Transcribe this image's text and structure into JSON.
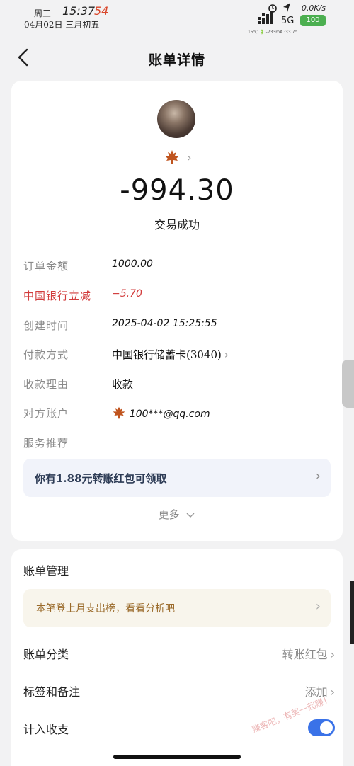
{
  "status_bar": {
    "weekday": "周三",
    "time": "15:37",
    "seconds": "54",
    "date": "04月02日  三月初五",
    "net_speed": "0.0K/s",
    "network": "5G",
    "battery": "100",
    "tiny_info": "15℃ 🔋 -733mA  ·33.7°"
  },
  "header": {
    "title": "账单详情"
  },
  "transaction": {
    "amount": "-994.30",
    "status": "交易成功",
    "details": [
      {
        "label": "订单金额",
        "value": "1000.00"
      },
      {
        "label": "中国银行立减",
        "value": "−5.70"
      },
      {
        "label": "创建时间",
        "value": "2025-04-02  15:25:55"
      },
      {
        "label": "付款方式",
        "value": "中国银行储蓄卡(3040)"
      },
      {
        "label": "收款理由",
        "value": "收款"
      },
      {
        "label": "对方账户",
        "value": "100***@qq.com"
      },
      {
        "label": "服务推荐",
        "value": ""
      }
    ],
    "promo": "你有1.88元转账红包可领取",
    "more": "更多"
  },
  "management": {
    "title": "账单管理",
    "tip": "本笔登上月支出榜，看看分析吧",
    "category_label": "账单分类",
    "category_value": "转账红包",
    "tag_label": "标签和备注",
    "tag_value": "添加",
    "income_label": "计入收支",
    "income_enabled": true
  },
  "watermark": "赚客吧，有奖一起赚！"
}
